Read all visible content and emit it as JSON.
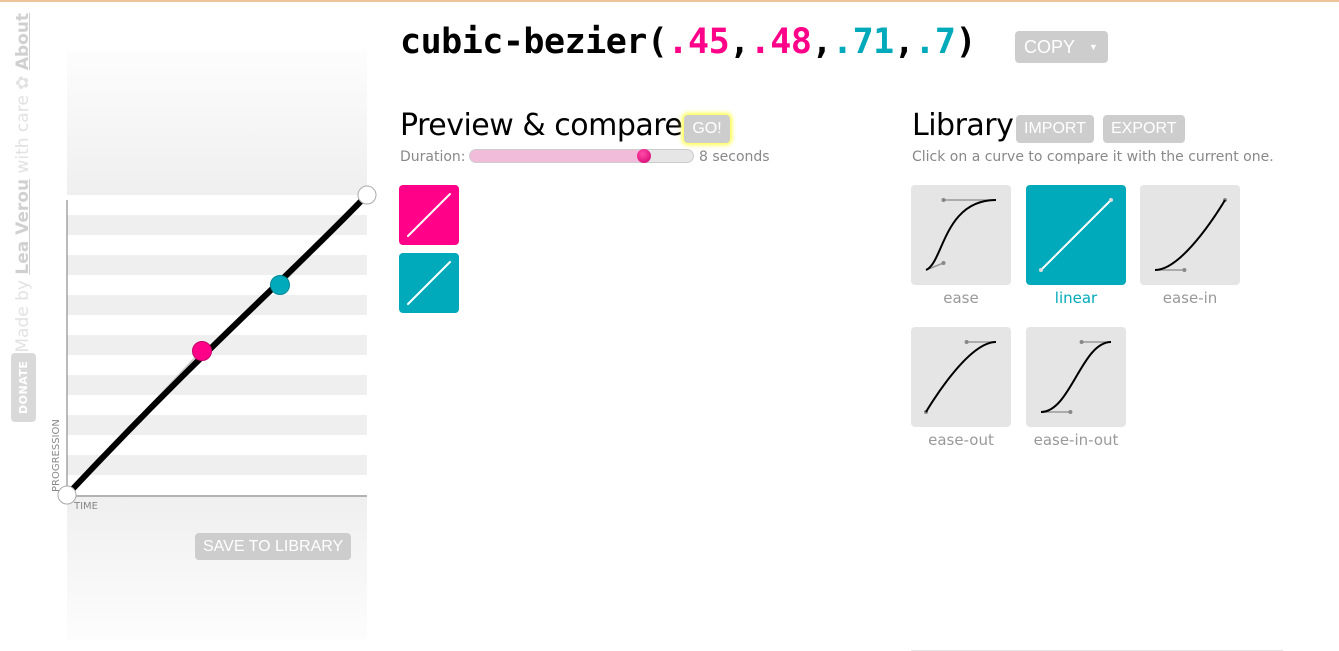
{
  "credit": {
    "made_by": "Made by ",
    "author": "Lea Verou",
    "with_care": " with care ✿ ",
    "about": "About",
    "donate": "DONATE"
  },
  "editor": {
    "x_axis_label": "TIME",
    "y_axis_label": "PROGRESSION",
    "save_label": "SAVE TO LIBRARY",
    "p1": [
      0.45,
      0.48
    ],
    "p2": [
      0.71,
      0.7
    ]
  },
  "code": {
    "prefix": "cubic-bezier(",
    "x1": ".45",
    "sep1": ",",
    "y1": ".48",
    "sep2": ",",
    "x2": ".71",
    "sep3": ",",
    "y2": ".7",
    "suffix": ")",
    "copy_label": "COPY",
    "copy_caret": "▼"
  },
  "preview": {
    "heading": "Preview & compare",
    "go_label": "GO!",
    "duration_label": "Duration:",
    "duration_value": "8 seconds",
    "duration_fraction": 0.78
  },
  "library": {
    "heading": "Library",
    "import_label": "IMPORT",
    "export_label": "EXPORT",
    "description": "Click on a curve to compare it with the current one.",
    "items": [
      {
        "name": "ease",
        "bezier": [
          0.25,
          0.1,
          0.25,
          1
        ],
        "selected": false
      },
      {
        "name": "linear",
        "bezier": [
          0,
          0,
          1,
          1
        ],
        "selected": true
      },
      {
        "name": "ease-in",
        "bezier": [
          0.42,
          0,
          1,
          1
        ],
        "selected": false
      },
      {
        "name": "ease-out",
        "bezier": [
          0,
          0,
          0.58,
          1
        ],
        "selected": false
      },
      {
        "name": "ease-in-out",
        "bezier": [
          0.42,
          0,
          0.58,
          1
        ],
        "selected": false
      }
    ]
  },
  "colors": {
    "pink": "#ff0088",
    "teal": "#00aabb",
    "button_gray": "#cdcdcd"
  }
}
